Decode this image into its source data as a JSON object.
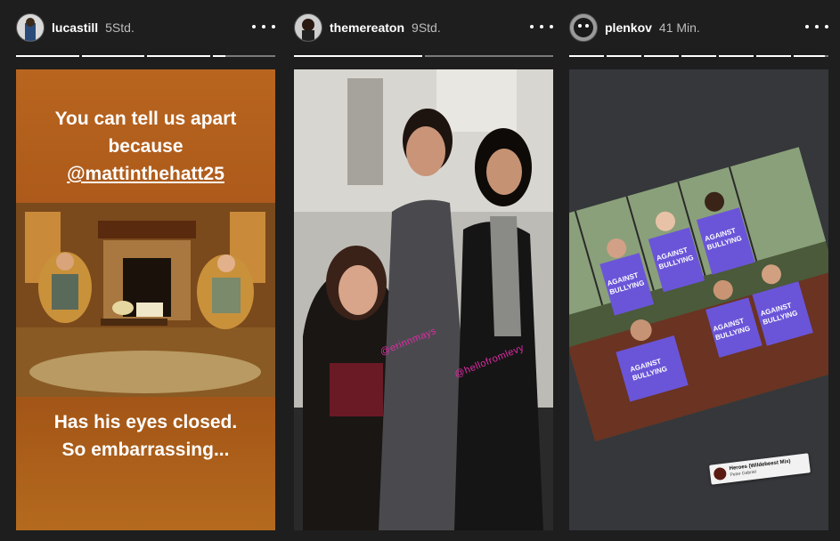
{
  "stories": [
    {
      "username": "lucastill",
      "time": "5Std.",
      "progress": [
        1,
        1,
        1,
        0.2
      ],
      "text_top": [
        "You can tell us apart",
        "because"
      ],
      "mention": "@mattinthehatt25",
      "text_bottom": [
        "Has his eyes closed.",
        "So embarrassing..."
      ]
    },
    {
      "username": "themereaton",
      "time": "9Std.",
      "progress": [
        1,
        0
      ],
      "tags": [
        "@erinnmays",
        "@hellofromlevy"
      ]
    },
    {
      "username": "plenkov",
      "time": "41 Min.",
      "progress": [
        1,
        1,
        1,
        1,
        1,
        1,
        0.9
      ],
      "shirt_text": "AGAINST BULLYING",
      "music": {
        "song": "Heroes (Wildebeest Mix)",
        "artist": "Peter Gabriel"
      }
    }
  ],
  "colors": {
    "background": "#1e1e1e",
    "story1_bg": "#a9561a",
    "tag_pink": "#e22ba8",
    "shirt_purple": "#6a55d8"
  }
}
